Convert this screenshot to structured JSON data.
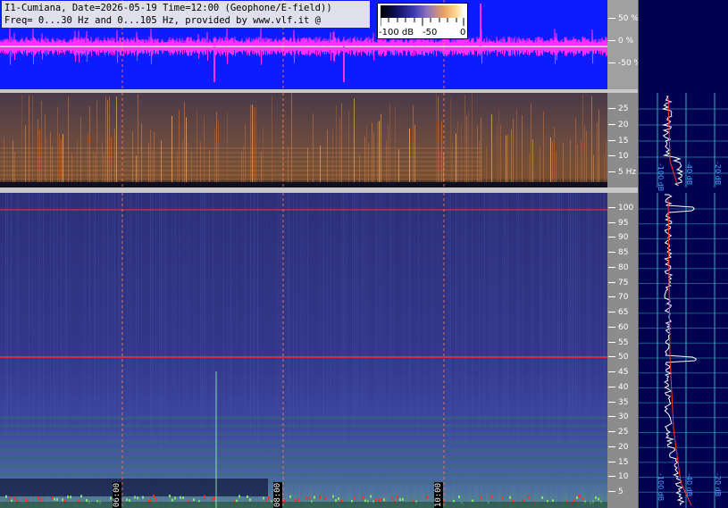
{
  "header": {
    "line1": "I1-Cumiana, Date=2026-05-19 Time=12:00 (Geophone/E-field))",
    "line2": "Freq= 0...30 Hz and 0...105 Hz, provided by www.vlf.it @"
  },
  "colorbar": {
    "labels": [
      "-100 dB",
      "-50",
      "0"
    ]
  },
  "waveform_axis": [
    "50 %",
    "0 %",
    "-50 %"
  ],
  "mid_axis": [
    "25",
    "20",
    "15",
    "10",
    "5 Hz"
  ],
  "main_axis": [
    "100",
    "95",
    "90",
    "85",
    "80",
    "75",
    "70",
    "65",
    "60",
    "55",
    "50",
    "45",
    "40",
    "35",
    "30",
    "25",
    "20",
    "15",
    "10",
    "5"
  ],
  "time_labels": [
    "06:00",
    "08:00",
    "10:00"
  ],
  "vlf_top_labels": [
    "-100 dB",
    "-40 dB",
    "-20 dB"
  ],
  "vlf_bottom_labels": [
    "-100 dB",
    "-40 dB",
    "-20 dB"
  ],
  "colors": {
    "waveform_bg": "#0d1bff",
    "waveform_trace": "#ff30ff",
    "spectrogram_bg": "#2e2f7a",
    "navy": "#000050",
    "grid": "#2fb0c0",
    "line_50hz": "#ff3030"
  }
}
